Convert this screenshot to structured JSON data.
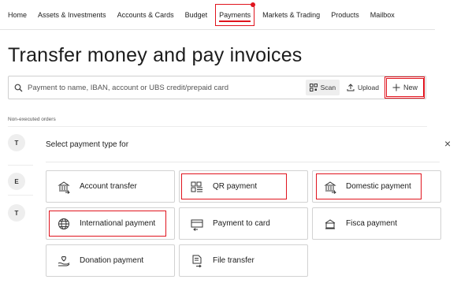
{
  "nav": {
    "items": [
      "Home",
      "Assets & Investments",
      "Accounts & Cards",
      "Budget",
      "Payments",
      "Markets & Trading",
      "Products",
      "Mailbox"
    ],
    "active": "Payments"
  },
  "page": {
    "title": "Transfer money and pay invoices"
  },
  "search": {
    "placeholder": "Payment to name, IBAN, account or UBS credit/prepaid card",
    "scan_label": "Scan",
    "upload_label": "Upload",
    "new_label": "New"
  },
  "orders": {
    "section_label": "Non-executed orders",
    "row_badges": [
      "T",
      "E",
      "T"
    ]
  },
  "panel": {
    "heading": "Select payment type for",
    "close_symbol": "×",
    "options": [
      {
        "label": "Account transfer",
        "icon": "bank-transfer-icon"
      },
      {
        "label": "QR payment",
        "icon": "qr-code-icon"
      },
      {
        "label": "Domestic payment",
        "icon": "bank-icon"
      },
      {
        "label": "International payment",
        "icon": "globe-icon"
      },
      {
        "label": "Payment to card",
        "icon": "card-icon"
      },
      {
        "label": "Fisca payment",
        "icon": "institution-icon"
      },
      {
        "label": "Donation payment",
        "icon": "donation-icon"
      },
      {
        "label": "File transfer",
        "icon": "file-transfer-icon"
      }
    ]
  },
  "colors": {
    "accent": "#e0141e",
    "border": "#d2d2d2"
  }
}
